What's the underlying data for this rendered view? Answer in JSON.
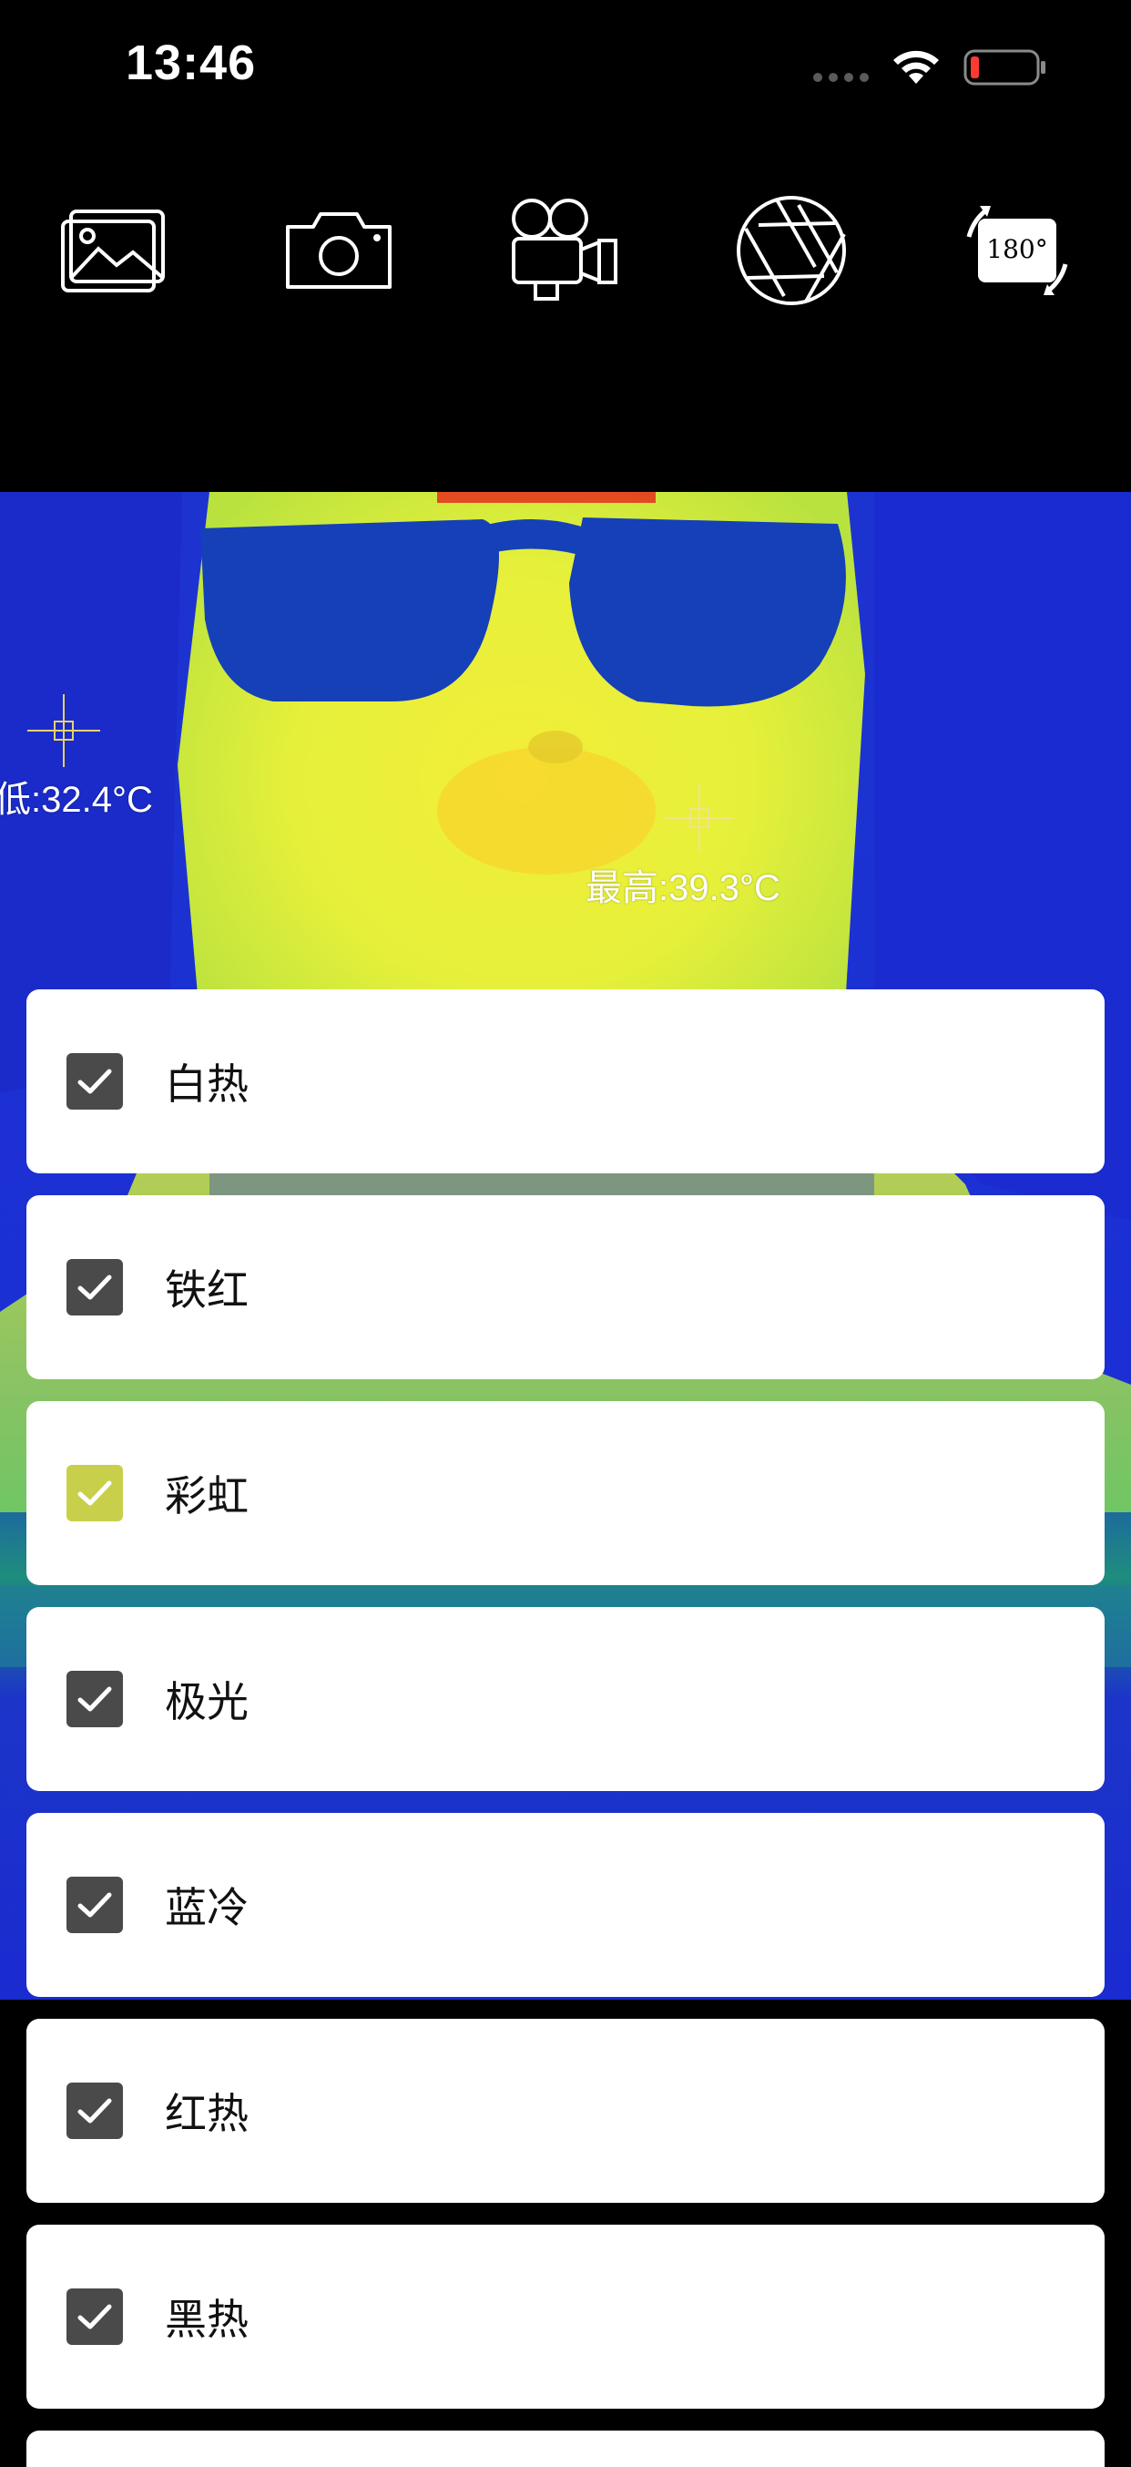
{
  "status": {
    "time": "13:46"
  },
  "toolbar": {
    "buttons": [
      {
        "icon": "gallery-icon"
      },
      {
        "icon": "camera-icon"
      },
      {
        "icon": "video-camera-icon"
      },
      {
        "icon": "aperture-icon"
      },
      {
        "icon": "rotate-180-icon",
        "text": "180°"
      }
    ]
  },
  "thermal": {
    "min_label": "低:32.4°C",
    "max_label": "最高:39.3°C"
  },
  "palettes": [
    {
      "label": "白热",
      "checked": true,
      "color": "#4a4a4a"
    },
    {
      "label": "铁红",
      "checked": true,
      "color": "#4a4a4a"
    },
    {
      "label": "彩虹",
      "checked": true,
      "color": "#c8d04b"
    },
    {
      "label": "极光",
      "checked": true,
      "color": "#4a4a4a"
    },
    {
      "label": "蓝冷",
      "checked": true,
      "color": "#4a4a4a"
    },
    {
      "label": "红热",
      "checked": true,
      "color": "#4a4a4a"
    },
    {
      "label": "黑热",
      "checked": true,
      "color": "#4a4a4a"
    }
  ]
}
